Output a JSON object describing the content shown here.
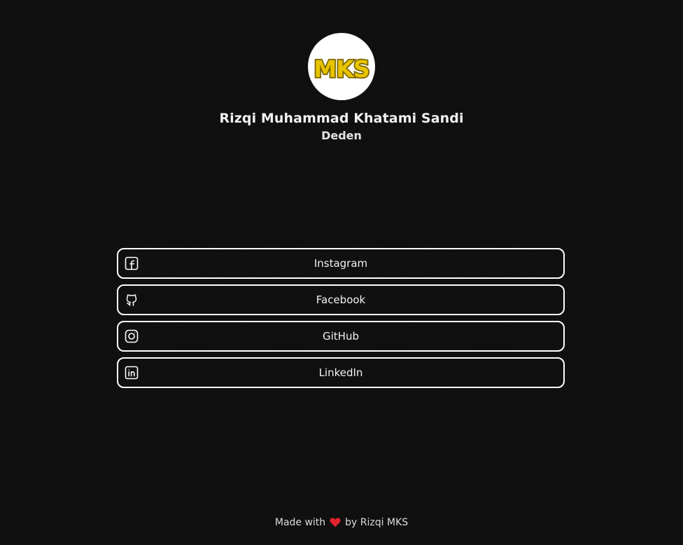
{
  "profile": {
    "avatar_text": "MKS",
    "name": "Rizqi Muhammad Khatami Sandi",
    "nickname": "Deden"
  },
  "links": [
    {
      "label": "Instagram",
      "icon": "facebook-icon"
    },
    {
      "label": "Facebook",
      "icon": "github-icon"
    },
    {
      "label": "GitHub",
      "icon": "instagram-icon"
    },
    {
      "label": "LinkedIn",
      "icon": "linkedin-icon"
    }
  ],
  "footer": {
    "prefix": "Made with",
    "icon": "heart-icon",
    "suffix": "by Rizqi MKS"
  },
  "colors": {
    "background": "#0d0d0d",
    "text": "#ffffff",
    "avatar_yellow": "#e8c400",
    "avatar_outline": "#7a6500",
    "heart": "#e0232e"
  }
}
